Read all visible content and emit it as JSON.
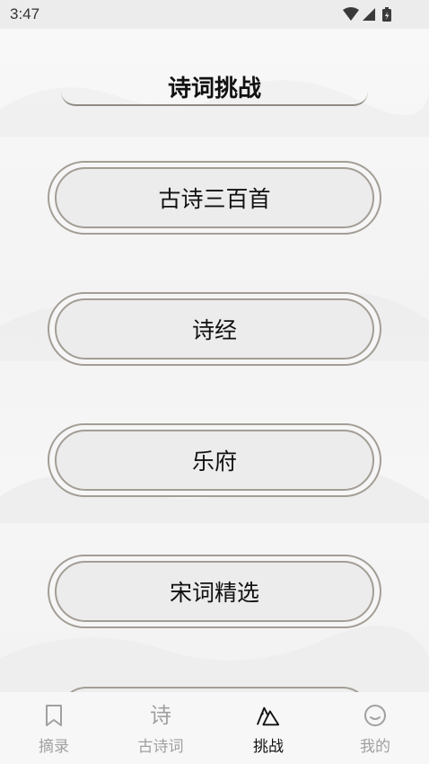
{
  "status_bar": {
    "time": "3:47",
    "icons": [
      "wifi-icon",
      "signal-icon",
      "battery-icon"
    ]
  },
  "header": {
    "title": "诗词挑战"
  },
  "categories": [
    {
      "label": "古诗三百首"
    },
    {
      "label": "诗经"
    },
    {
      "label": "乐府"
    },
    {
      "label": "宋词精选"
    }
  ],
  "tab_bar": {
    "tabs": [
      {
        "label": "摘录",
        "icon": "bookmark-icon",
        "active": false
      },
      {
        "label": "古诗词",
        "icon": "poem-icon",
        "active": false
      },
      {
        "label": "挑战",
        "icon": "mountain-icon",
        "active": true
      },
      {
        "label": "我的",
        "icon": "smile-icon",
        "active": false
      }
    ]
  },
  "colors": {
    "border": "#a39e95",
    "pill_fill": "#ececec",
    "active_tab": "#111111",
    "inactive_tab": "#a0a0a0"
  }
}
